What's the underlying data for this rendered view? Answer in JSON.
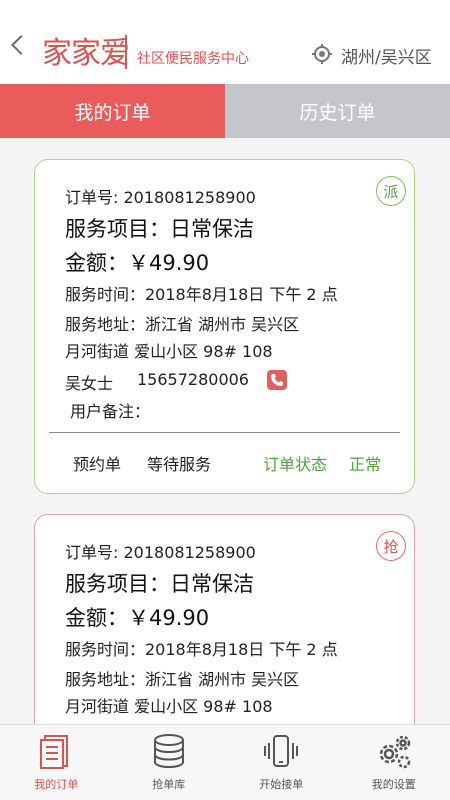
{
  "header": {
    "logo_text": "家家爱",
    "slogan": "社区便民服务中心",
    "location": "湖州/吴兴区"
  },
  "tabs": [
    {
      "label": "我的订单",
      "active": true
    },
    {
      "label": "历史订单",
      "active": false
    }
  ],
  "orders": [
    {
      "badge": "派",
      "order_no": "订单号:  2018081258900",
      "service": "服务项目：日常保洁",
      "amount": "金额：￥49.90",
      "time": "服务时间：2018年8月18日  下午 2 点",
      "address1": "服务地址：浙江省  湖州市  吴兴区",
      "address2": "月河街道  爱山小区  98#  108",
      "customer": "吴女士",
      "phone": "15657280006",
      "remark": "用户备注：",
      "type": "预约单",
      "state": "等待服务",
      "status_label": "订单状态",
      "status_value": "正常"
    },
    {
      "badge": "抢",
      "order_no": "订单号:  2018081258900",
      "service": "服务项目：日常保洁",
      "amount": "金额：￥49.90",
      "time": "服务时间：2018年8月18日  下午 2 点",
      "address1": "服务地址：浙江省  湖州市  吴兴区",
      "address2": "月河街道  爱山小区  98#  108"
    }
  ],
  "nav": [
    {
      "label": "我的订单",
      "icon": "document-icon",
      "active": true
    },
    {
      "label": "抢单库",
      "icon": "database-icon",
      "active": false
    },
    {
      "label": "开始接单",
      "icon": "phone-vibrate-icon",
      "active": false
    },
    {
      "label": "我的设置",
      "icon": "gear-icon",
      "active": false
    }
  ],
  "colors": {
    "accent": "#ea5b5b",
    "tab_inactive": "#c4c6cc",
    "green": "#4ca43a"
  }
}
